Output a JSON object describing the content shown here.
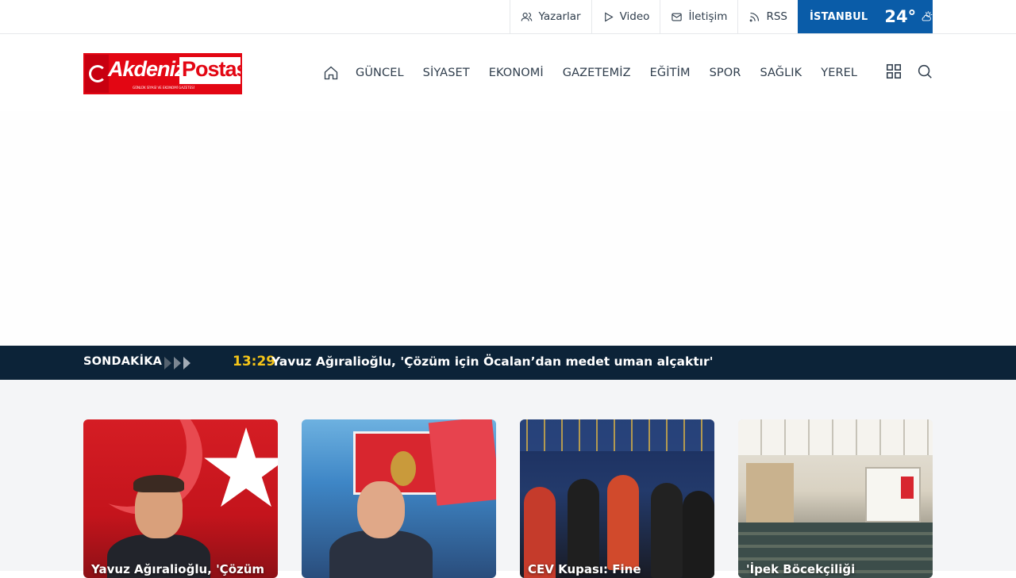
{
  "topbar": {
    "links": [
      {
        "label": "Yazarlar",
        "icon": "users-icon"
      },
      {
        "label": "Video",
        "icon": "play-icon"
      },
      {
        "label": "İletişim",
        "icon": "mail-icon"
      },
      {
        "label": "RSS",
        "icon": "rss-icon"
      }
    ],
    "weather": {
      "city": "İSTANBUL",
      "temp": "24°",
      "icon": "partly-cloudy-icon"
    }
  },
  "header": {
    "logo": {
      "part1": "Akdeniz",
      "part2": "Postası",
      "tagline": "GÜNLÜK SİYASİ VE EKONOMİ GAZETESİ"
    },
    "nav": [
      "GÜNCEL",
      "SİYASET",
      "EKONOMİ",
      "GAZETEMİZ",
      "EĞİTİM",
      "SPOR",
      "SAĞLIK",
      "YEREL"
    ]
  },
  "breaking": {
    "label": "SONDAKİKA",
    "time": "13:29",
    "headline": "Yavuz Ağıralioğlu, 'Çözüm için Öcalan’dan medet uman alçaktır'"
  },
  "cards": [
    {
      "title": "Yavuz Ağıralioğlu, 'Çözüm"
    },
    {
      "title": ""
    },
    {
      "title": "CEV Kupası: Fine"
    },
    {
      "title": "'İpek Böcekçiliği"
    }
  ],
  "colors": {
    "weather_bg": "#0a5ca8",
    "breaking_bg": "#0c2338",
    "breaking_time": "#f5c518",
    "logo_red": "#e30613"
  }
}
